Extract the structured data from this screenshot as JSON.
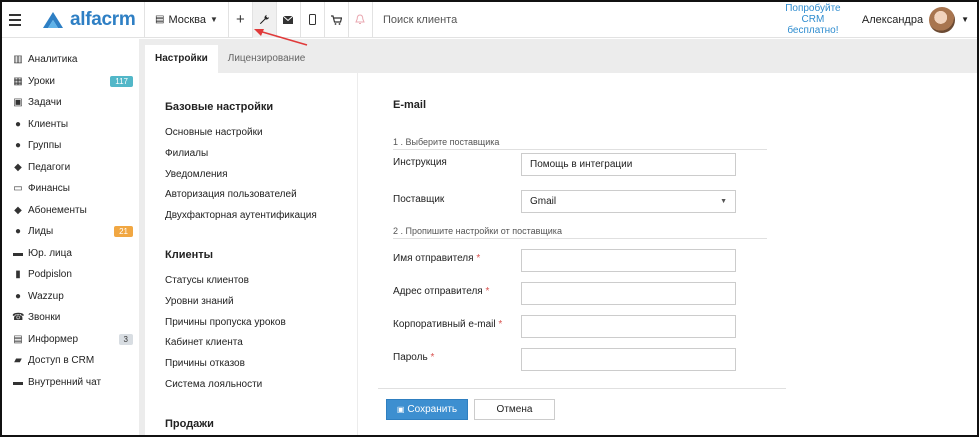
{
  "topbar": {
    "brand": "alfacrm",
    "city": "Москва",
    "search_placeholder": "Поиск клиента",
    "promo_line1": "Попробуйте",
    "promo_line2": "CRM бесплатно!",
    "user_name": "Александра"
  },
  "sidebar": {
    "items": [
      {
        "label": "Аналитика",
        "icon": "chart-icon"
      },
      {
        "label": "Уроки",
        "icon": "calendar-icon",
        "badge": "117"
      },
      {
        "label": "Задачи",
        "icon": "clipboard-icon"
      },
      {
        "label": "Клиенты",
        "icon": "user-icon"
      },
      {
        "label": "Группы",
        "icon": "users-icon"
      },
      {
        "label": "Педагоги",
        "icon": "graduation-cap-icon"
      },
      {
        "label": "Финансы",
        "icon": "money-icon"
      },
      {
        "label": "Абонементы",
        "icon": "tag-icon"
      },
      {
        "label": "Лиды",
        "icon": "user-icon",
        "badge": "21"
      },
      {
        "label": "Юр. лица",
        "icon": "briefcase-icon"
      },
      {
        "label": "Podpislon",
        "icon": "document-icon"
      },
      {
        "label": "Wazzup",
        "icon": "whatsapp-icon"
      },
      {
        "label": "Звонки",
        "icon": "phone-icon"
      },
      {
        "label": "Информер",
        "icon": "newspaper-icon",
        "badge": "3"
      },
      {
        "label": "Доступ в CRM",
        "icon": "lock-icon"
      },
      {
        "label": "Внутренний чат",
        "icon": "chat-icon"
      }
    ]
  },
  "tabs": {
    "settings": "Настройки",
    "licensing": "Лицензирование"
  },
  "settings_menu": {
    "basic_title": "Базовые настройки",
    "basic": [
      "Основные настройки",
      "Филиалы",
      "Уведомления",
      "Авторизация пользователей",
      "Двухфакторная аутентификация"
    ],
    "clients_title": "Клиенты",
    "clients": [
      "Статусы клиентов",
      "Уровни знаний",
      "Причины пропуска уроков",
      "Кабинет клиента",
      "Причины отказов",
      "Система лояльности"
    ],
    "sales_title": "Продажи"
  },
  "email_form": {
    "title": "E-mail",
    "step1": "1 . Выберите поставщика",
    "instruction_label": "Инструкция",
    "instruction_value": "Помощь в интеграции",
    "provider_label": "Поставщик",
    "provider_value": "Gmail",
    "step2": "2 . Пропишите настройки от поставщика",
    "sender_name_label": "Имя отправителя",
    "sender_address_label": "Адрес отправителя",
    "corporate_email_label": "Корпоративный e-mail",
    "password_label": "Пароль",
    "required_mark": "*",
    "save_label": "Сохранить",
    "cancel_label": "Отмена"
  },
  "colors": {
    "brand": "#2e7fc4",
    "primary_button": "#3d8fd0",
    "badge_teal": "#52b7c8",
    "badge_orange": "#f1a742",
    "annotation_arrow": "#e03a3a"
  }
}
